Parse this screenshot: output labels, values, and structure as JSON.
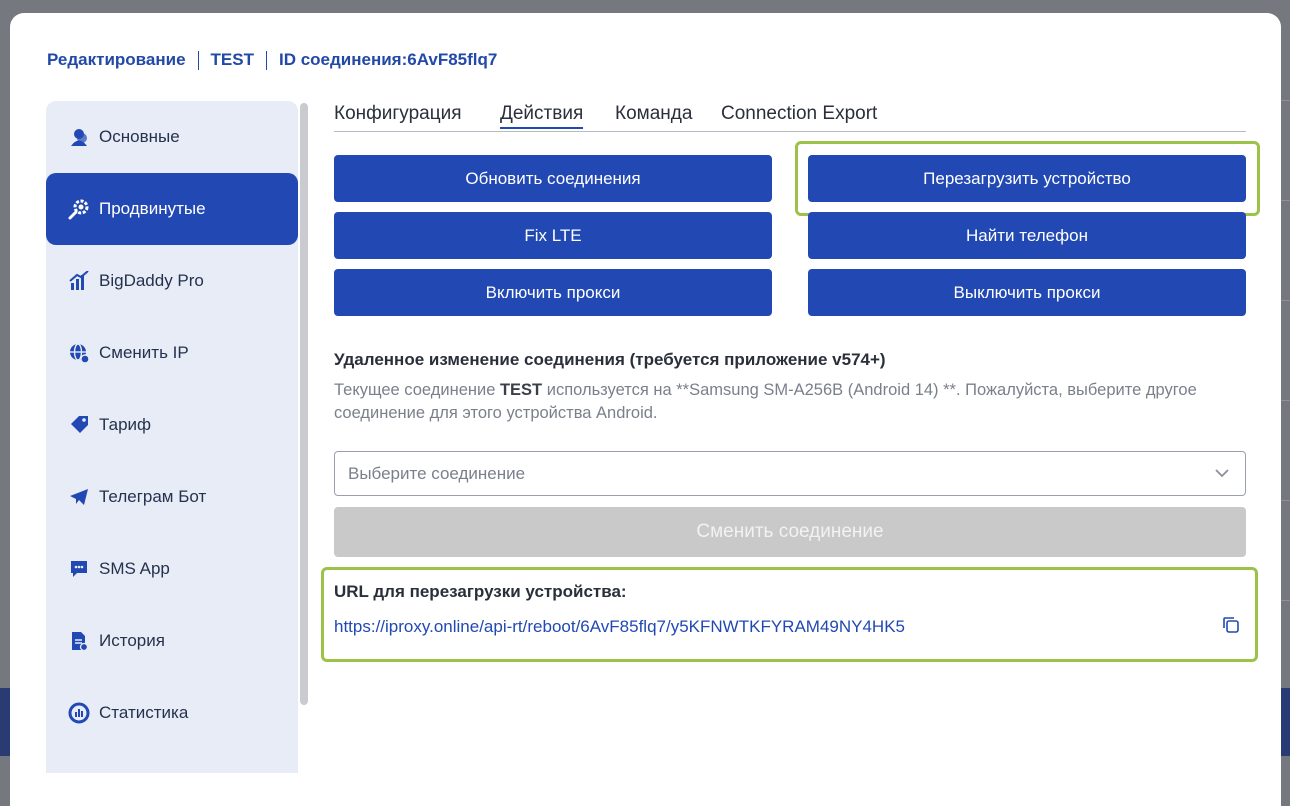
{
  "breadcrumb": {
    "edit": "Редактирование",
    "name": "TEST",
    "connection_id": "ID соединения:6AvF85flq7"
  },
  "sidebar": {
    "items": [
      {
        "label": "Основные",
        "icon": "user-icon"
      },
      {
        "label": "Продвинутые",
        "icon": "gear-search-icon",
        "active": true
      },
      {
        "label": "BigDaddy Pro",
        "icon": "chart-icon"
      },
      {
        "label": "Сменить IP",
        "icon": "globe-icon"
      },
      {
        "label": "Тариф",
        "icon": "tag-icon"
      },
      {
        "label": "Телеграм Бот",
        "icon": "telegram-icon"
      },
      {
        "label": "SMS App",
        "icon": "chat-icon"
      },
      {
        "label": "История",
        "icon": "document-icon"
      },
      {
        "label": "Статистика",
        "icon": "stats-icon"
      }
    ]
  },
  "tabs": [
    {
      "label": "Конфигурация"
    },
    {
      "label": "Действия",
      "active": true
    },
    {
      "label": "Команда"
    },
    {
      "label": "Connection Export"
    }
  ],
  "actions": {
    "refresh": "Обновить соединения",
    "reboot": "Перезагрузить устройство",
    "fix_lte": "Fix LTE",
    "find_phone": "Найти телефон",
    "enable_proxy": "Включить прокси",
    "disable_proxy": "Выключить прокси"
  },
  "remote": {
    "title": "Удаленное изменение соединения (требуется приложение v574+)",
    "desc_prefix": "Текущее соединение ",
    "desc_conn": "TEST",
    "desc_suffix": " используется на **Samsung SM-A256B (Android 14) **. Пожалуйста, выберите другое соединение для этого устройства Android.",
    "select_placeholder": "Выберите соединение",
    "change_button": "Сменить соединение"
  },
  "reboot_url": {
    "label": "URL для перезагрузки устройства:",
    "url": "https://iproxy.online/api-rt/reboot/6AvF85flq7/y5KFNWTKFYRAM49NY4HK5"
  },
  "colors": {
    "primary": "#2249b3",
    "highlight": "#9cc24a",
    "disabled": "#c9c9c9"
  }
}
